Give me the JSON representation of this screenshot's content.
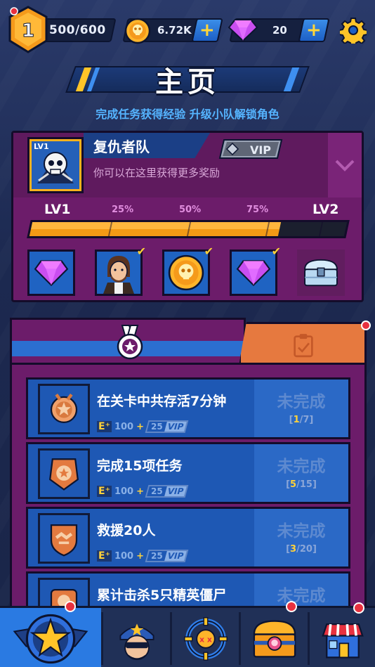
{
  "topbar": {
    "level": "1",
    "xp": "500/600",
    "coins": "6.72K",
    "gems": "20",
    "plus_label": "+"
  },
  "page": {
    "title": "主页",
    "subtitle": "完成任务获得经验  升级小队解锁角色"
  },
  "team": {
    "level_tag": "LV1",
    "name": "复仇者队",
    "vip_label": "VIP",
    "description": "你可以在这里获得更多奖励",
    "progress": {
      "start_label": "LV1",
      "end_label": "LV2",
      "marks": [
        "25%",
        "50%",
        "75%"
      ],
      "fill_fraction": 0.79
    },
    "rewards": [
      {
        "icon": "gem-icon",
        "checked": false
      },
      {
        "icon": "hero-portrait-icon",
        "checked": true
      },
      {
        "icon": "skull-coin-icon",
        "checked": true
      },
      {
        "icon": "gem-icon",
        "checked": true
      },
      {
        "icon": "chest-icon",
        "checked": false
      }
    ]
  },
  "tasks": [
    {
      "name": "在关卡中共存活7分钟",
      "xp": "100",
      "vip_xp": "25",
      "vip_label": "VIP",
      "status": "未完成",
      "current": "1",
      "total": "7",
      "icon": "medal-icon"
    },
    {
      "name": "完成15项任务",
      "xp": "100",
      "vip_xp": "25",
      "vip_label": "VIP",
      "status": "未完成",
      "current": "5",
      "total": "15",
      "icon": "trophy-badge-icon"
    },
    {
      "name": "救援20人",
      "xp": "100",
      "vip_xp": "25",
      "vip_label": "VIP",
      "status": "未完成",
      "current": "3",
      "total": "20",
      "icon": "handshake-shield-icon"
    },
    {
      "name": "累计击杀5只精英僵尸",
      "status": "未完成",
      "icon": "skull-badge-icon"
    }
  ],
  "colors": {
    "accent_blue": "#2a7ae2",
    "panel_purple": "#6c1c6a",
    "tab_orange": "#e6793f",
    "gold": "#ffd23a"
  }
}
